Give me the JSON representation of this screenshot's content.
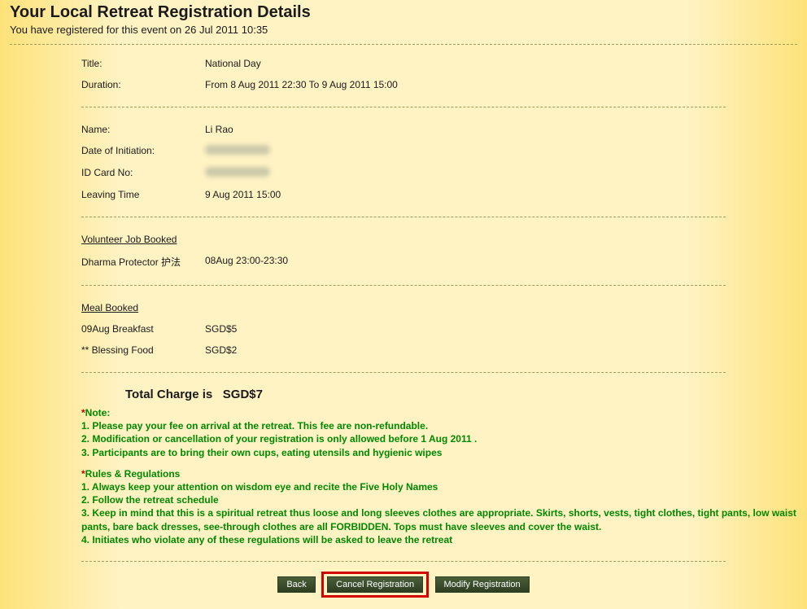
{
  "header": {
    "title": "Your Local Retreat Registration Details",
    "subtitle": "You have registered for this event on 26 Jul 2011 10:35"
  },
  "event": {
    "title_label": "Title:",
    "title_value": "National Day",
    "duration_label": "Duration:",
    "duration_value": "From 8 Aug 2011 22:30 To 9 Aug 2011 15:00"
  },
  "person": {
    "name_label": "Name:",
    "name_value": "Li Rao",
    "doi_label": "Date of Initiation:",
    "id_label": "ID Card No:",
    "leaving_label": "Leaving Time",
    "leaving_value": "9 Aug 2011 15:00"
  },
  "volunteer": {
    "heading": "Volunteer Job Booked",
    "job_label": "Dharma Protector 护法",
    "job_value": "08Aug 23:00-23:30"
  },
  "meal": {
    "heading": "Meal Booked",
    "items": [
      {
        "label": "09Aug Breakfast",
        "value": "SGD$5"
      },
      {
        "label": "** Blessing Food",
        "value": "SGD$2"
      }
    ]
  },
  "total": {
    "label": "Total Charge is",
    "value": "SGD$7"
  },
  "notes": {
    "note_heading": "Note:",
    "note1": "1. Please pay your fee on arrival at the retreat. This fee are non-refundable.",
    "note2": "2. Modification or cancellation of your registration is only allowed before 1 Aug 2011 .",
    "note3": "3. Participants are to bring their own cups, eating utensils and hygienic wipes",
    "rules_heading": "Rules & Regulations",
    "rule1": "1. Always keep your attention on wisdom eye and recite the Five Holy Names",
    "rule2": "2. Follow the retreat schedule",
    "rule3": "3. Keep in mind that this is a spiritual retreat thus loose and long sleeves clothes are appropriate. Skirts, shorts, vests, tight clothes, tight pants, low waist pants, bare back dresses, see-through clothes are all FORBIDDEN. Tops must have sleeves and cover the waist.",
    "rule4": "4. Initiates who violate any of these regulations will be asked to leave the retreat"
  },
  "buttons": {
    "back": "Back",
    "cancel": "Cancel Registration",
    "modify": "Modify Registration"
  }
}
